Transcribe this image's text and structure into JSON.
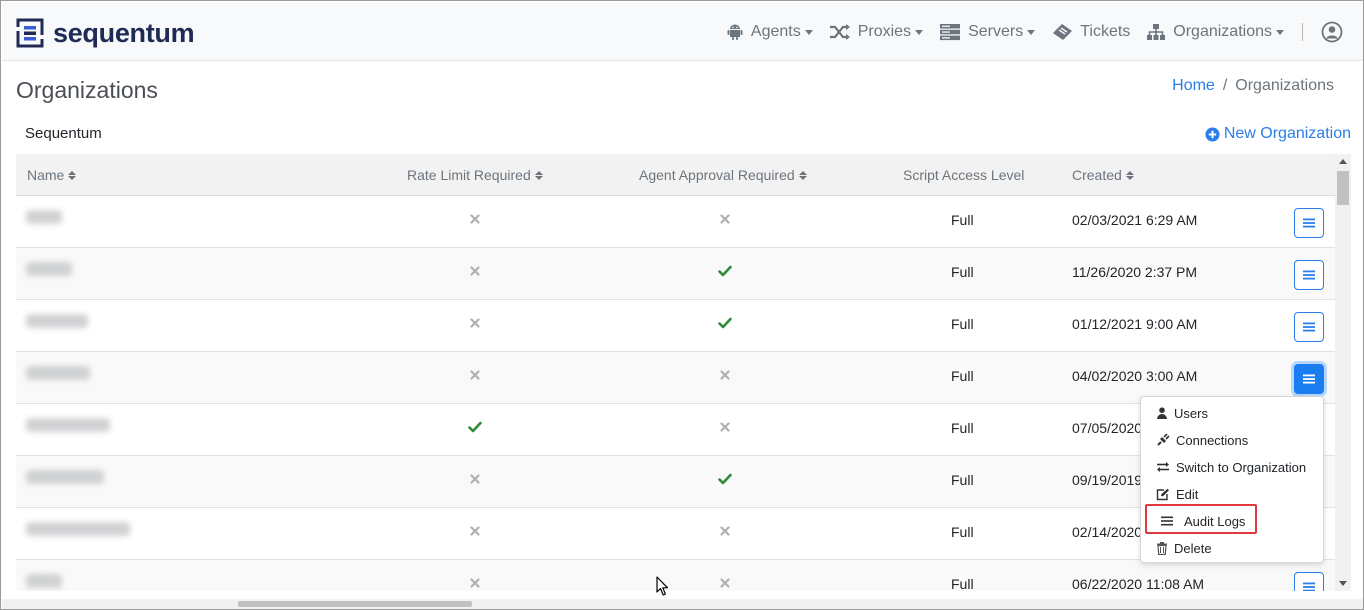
{
  "brand": {
    "name": "sequentum",
    "color": "#1f2a55"
  },
  "nav": {
    "items": [
      {
        "label": "Agents",
        "icon": "android-icon",
        "dropdown": true
      },
      {
        "label": "Proxies",
        "icon": "shuffle-icon",
        "dropdown": true
      },
      {
        "label": "Servers",
        "icon": "server-icon",
        "dropdown": true
      },
      {
        "label": "Tickets",
        "icon": "ticket-icon",
        "dropdown": false
      },
      {
        "label": "Organizations",
        "icon": "sitemap-icon",
        "dropdown": true
      }
    ],
    "user_icon": "user-circle-icon"
  },
  "page": {
    "title": "Organizations",
    "breadcrumb": {
      "home": "Home",
      "sep": "/",
      "current": "Organizations"
    },
    "org_name": "Sequentum",
    "new_org_label": "New Organization"
  },
  "table": {
    "columns": [
      "Name",
      "Rate Limit Required",
      "Agent Approval Required",
      "Script Access Level",
      "Created"
    ],
    "rows": [
      {
        "rate": false,
        "approval": false,
        "access": "Full",
        "created": "02/03/2021 6:29 AM"
      },
      {
        "rate": false,
        "approval": true,
        "access": "Full",
        "created": "11/26/2020 2:37 PM"
      },
      {
        "rate": false,
        "approval": true,
        "access": "Full",
        "created": "01/12/2021 9:00 AM"
      },
      {
        "rate": false,
        "approval": false,
        "access": "Full",
        "created": "04/02/2020 3:00 AM"
      },
      {
        "rate": true,
        "approval": false,
        "access": "Full",
        "created": "07/05/2020"
      },
      {
        "rate": false,
        "approval": true,
        "access": "Full",
        "created": "09/19/2019"
      },
      {
        "rate": false,
        "approval": false,
        "access": "Full",
        "created": "02/14/2020"
      },
      {
        "rate": false,
        "approval": false,
        "access": "Full",
        "created": "06/22/2020 11:08 AM"
      }
    ]
  },
  "dropdown_menu": {
    "items": [
      {
        "label": "Users",
        "icon": "user-icon"
      },
      {
        "label": "Connections",
        "icon": "plug-icon"
      },
      {
        "label": "Switch to Organization",
        "icon": "exchange-icon"
      },
      {
        "label": "Edit",
        "icon": "edit-icon"
      },
      {
        "label": "Audit Logs",
        "icon": "list-icon"
      },
      {
        "label": "Delete",
        "icon": "trash-icon"
      }
    ],
    "highlighted": "Audit Logs"
  },
  "colors": {
    "accent": "#2b7de9",
    "check": "#2e8b3a",
    "cross": "#b0b0b0",
    "highlight": "#e0393e"
  }
}
